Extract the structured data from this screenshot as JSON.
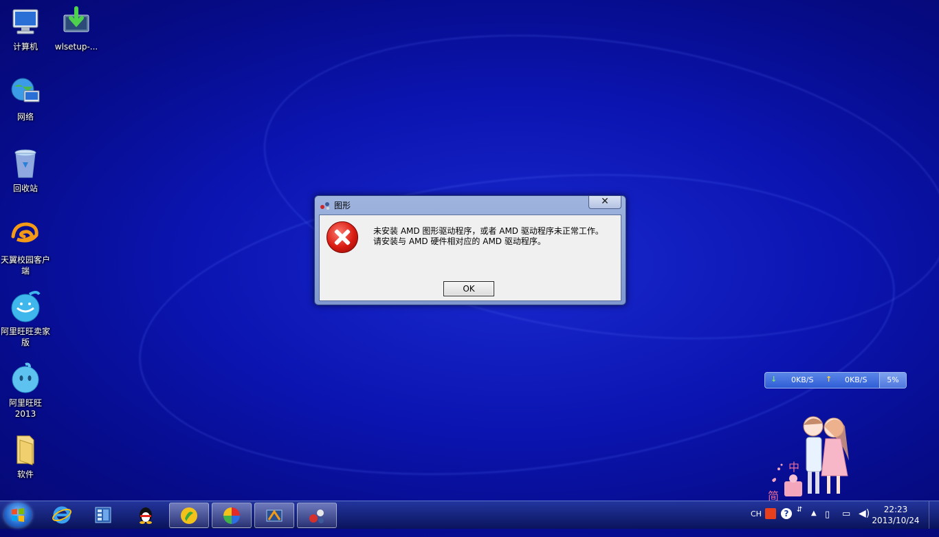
{
  "desktop": {
    "icons": [
      {
        "label": "计算机"
      },
      {
        "label": "wlsetup-..."
      },
      {
        "label": "网络"
      },
      {
        "label": "回收站"
      },
      {
        "label": "天翼校园客户端"
      },
      {
        "label": "阿里旺旺卖家版"
      },
      {
        "label": "阿里旺旺2013"
      },
      {
        "label": "软件"
      }
    ]
  },
  "dialog": {
    "title": "图形",
    "close_glyph": "✕",
    "message_line1": "未安装 AMD 图形驱动程序，或者 AMD 驱动程序未正常工作。",
    "message_line2": "请安装与 AMD 硬件相对应的 AMD 驱动程序。",
    "ok_label": "OK"
  },
  "netmeter": {
    "download": "0KB/S",
    "upload": "0KB/S",
    "cpu": "5%"
  },
  "ime": {
    "mode": "中",
    "charset": "简"
  },
  "taskbar": {
    "items": [
      {
        "icon": "ie-icon"
      },
      {
        "icon": "media-library-icon"
      },
      {
        "icon": "qq-penguin-icon"
      },
      {
        "icon": "green-app-icon"
      },
      {
        "icon": "color-wheel-icon"
      },
      {
        "icon": "video-editor-icon"
      },
      {
        "icon": "amd-tool-icon"
      }
    ],
    "tray": {
      "lang": "CH",
      "clock_time": "22:23",
      "clock_date": "2013/10/24"
    }
  },
  "colors": {
    "desktop_bg": "#0b14b0",
    "dialog_frame": "#8fa6d8",
    "error_red": "#d81b12"
  }
}
